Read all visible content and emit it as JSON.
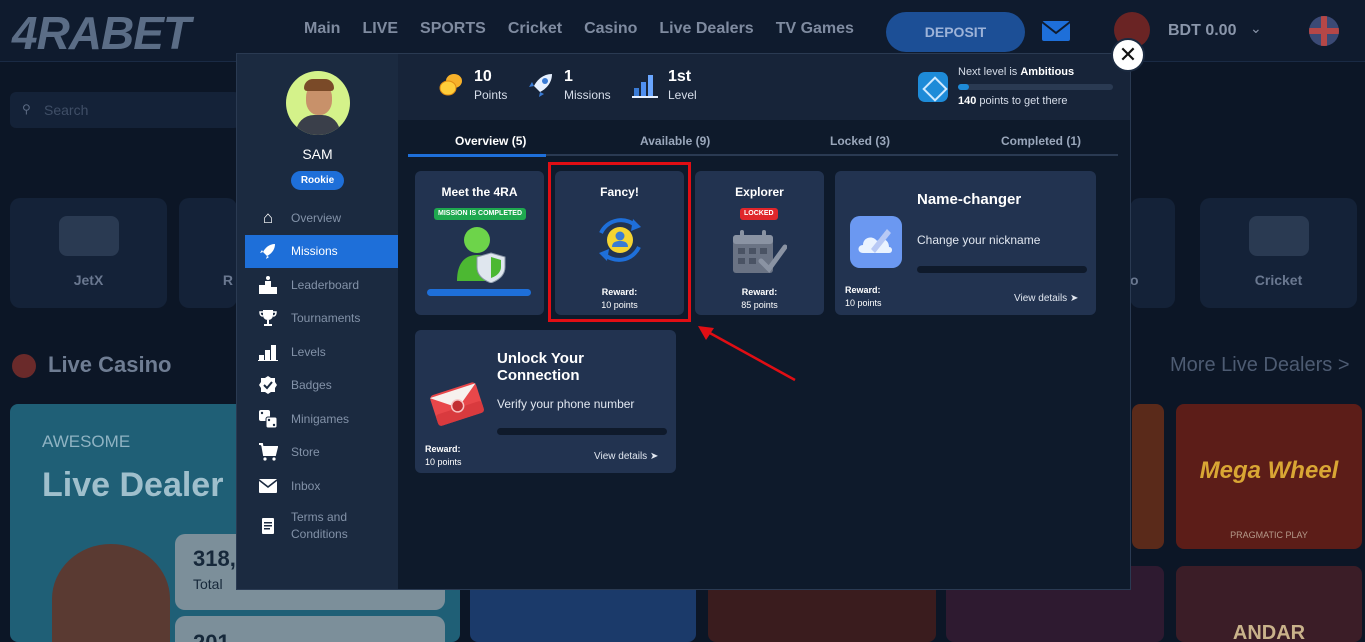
{
  "site": {
    "logo": "4RABET",
    "nav": [
      "Main",
      "LIVE",
      "SPORTS",
      "Cricket",
      "Casino",
      "Live Dealers",
      "TV Games"
    ],
    "deposit_label": "DEPOSIT",
    "balance": "BDT 0.00",
    "search_placeholder": "Search",
    "games": [
      "JetX",
      "R",
      "o",
      "Cricket"
    ],
    "live_casino_title": "Live Casino",
    "more_live_dealers": "More Live Dealers >",
    "promo": {
      "tagline": "AWESOME",
      "title": "Live Dealer",
      "stat1_value": "318,",
      "stat1_label": "Total",
      "stat2_value": "201"
    },
    "mega_wheel": "Mega Wheel",
    "pragmatic": "PRAGMATIC PLAY",
    "andar": "ANDAR"
  },
  "modal": {
    "profile": {
      "name": "SAM",
      "rank": "Rookie"
    },
    "menu": [
      {
        "label": "Overview",
        "icon": "home-icon",
        "glyph": "⌂"
      },
      {
        "label": "Missions",
        "icon": "rocket-icon",
        "glyph": "🚀"
      },
      {
        "label": "Leaderboard",
        "icon": "podium-icon",
        "glyph": "▟"
      },
      {
        "label": "Tournaments",
        "icon": "trophy-icon",
        "glyph": "🏆"
      },
      {
        "label": "Levels",
        "icon": "levels-icon",
        "glyph": "▁▃▅"
      },
      {
        "label": "Badges",
        "icon": "badge-icon",
        "glyph": "✔"
      },
      {
        "label": "Minigames",
        "icon": "dice-icon",
        "glyph": "⚃"
      },
      {
        "label": "Store",
        "icon": "cart-icon",
        "glyph": "🛒"
      },
      {
        "label": "Inbox",
        "icon": "mail-icon",
        "glyph": "✉"
      },
      {
        "label": "Terms and Conditions",
        "icon": "document-icon",
        "glyph": "▤"
      }
    ],
    "active_menu": "Missions",
    "stats": {
      "points_value": "10",
      "points_label": "Points",
      "missions_value": "1",
      "missions_label": "Missions",
      "level_value": "1st",
      "level_label": "Level"
    },
    "next_level": {
      "prefix": "Next level is",
      "name": "Ambitious",
      "points_needed": "140",
      "suffix": "points to get there",
      "progress": 0.07
    },
    "tabs": [
      {
        "label": "Overview (5)"
      },
      {
        "label": "Available (9)"
      },
      {
        "label": "Locked (3)"
      },
      {
        "label": "Completed (1)"
      }
    ],
    "missions": [
      {
        "title": "Meet the 4RA",
        "badge": "MISSION IS COMPLETED",
        "progress": 1.0
      },
      {
        "title": "Fancy!",
        "reward_label": "Reward:",
        "reward": "10 points"
      },
      {
        "title": "Explorer",
        "badge": "LOCKED",
        "reward_label": "Reward:",
        "reward": "85 points"
      }
    ],
    "wide_missions": [
      {
        "title": "Name-changer",
        "subtitle": "Change your nickname",
        "reward_label": "Reward:",
        "reward": "10 points",
        "link": "View details"
      },
      {
        "title": "Unlock Your Connection",
        "subtitle": "Verify your phone number",
        "reward_label": "Reward:",
        "reward": "10 points",
        "link": "View details"
      }
    ],
    "close_glyph": "✕"
  },
  "colors": {
    "accent": "#1e6fd9",
    "highlight": "#e00e14",
    "completed_badge": "#1fa84f",
    "locked_badge": "#e0262b"
  }
}
